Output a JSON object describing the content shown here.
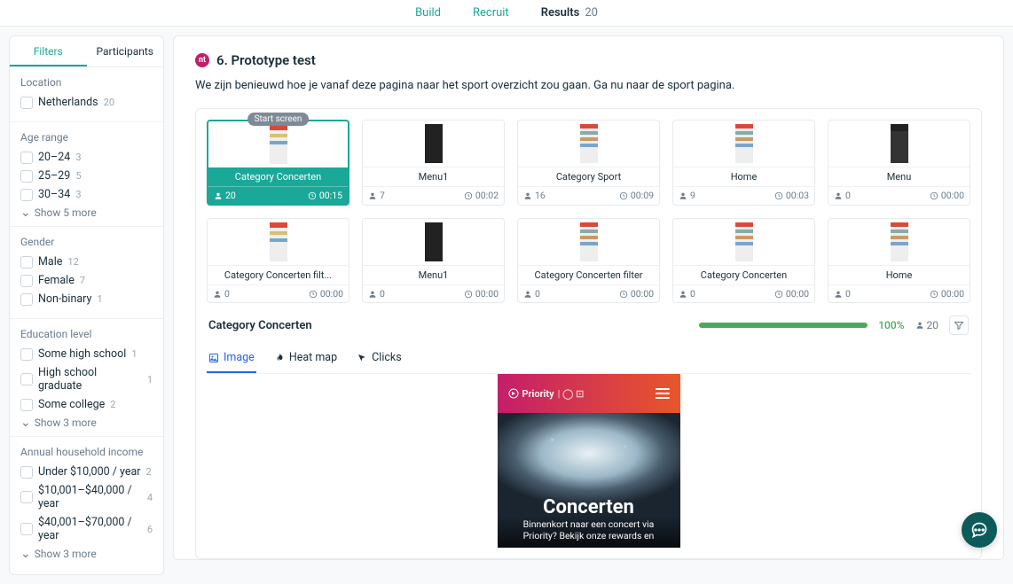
{
  "nav": {
    "steps": [
      {
        "label": "Build",
        "active": false,
        "link": true
      },
      {
        "label": "Recruit",
        "active": false,
        "link": true
      },
      {
        "label": "Results",
        "active": true,
        "count": "20"
      }
    ]
  },
  "sidebar_tabs": {
    "filters": "Filters",
    "participants": "Participants"
  },
  "filters": {
    "location": {
      "title": "Location",
      "items": [
        {
          "label": "Netherlands",
          "count": "20"
        }
      ]
    },
    "age": {
      "title": "Age range",
      "items": [
        {
          "label": "20–24",
          "count": "3"
        },
        {
          "label": "25–29",
          "count": "5"
        },
        {
          "label": "30–34",
          "count": "3"
        }
      ],
      "more": "Show 5 more"
    },
    "gender": {
      "title": "Gender",
      "items": [
        {
          "label": "Male",
          "count": "12"
        },
        {
          "label": "Female",
          "count": "7"
        },
        {
          "label": "Non-binary",
          "count": "1"
        }
      ]
    },
    "education": {
      "title": "Education level",
      "items": [
        {
          "label": "Some high school",
          "count": "1"
        },
        {
          "label": "High school graduate",
          "count": "1"
        },
        {
          "label": "Some college",
          "count": "2"
        }
      ],
      "more": "Show 3 more"
    },
    "income": {
      "title": "Annual household income",
      "items": [
        {
          "label": "Under $10,000 / year",
          "count": "2"
        },
        {
          "label": "$10,001–$40,000 / year",
          "count": "4"
        },
        {
          "label": "$40,001–$70,000 / year",
          "count": "6"
        }
      ],
      "more": "Show 3 more"
    }
  },
  "section": {
    "badge": "nt",
    "title": "6. Prototype test",
    "description": "We zijn benieuwd hoe je vanaf deze pagina naar het sport overzicht zou gaan. Ga nu naar de sport pagina."
  },
  "start_tag": "Start screen",
  "screens": [
    {
      "name": "Category Concerten",
      "people": "20",
      "time": "00:15",
      "selected": true,
      "thumb": "phonelike"
    },
    {
      "name": "Menu1",
      "people": "7",
      "time": "00:02",
      "thumb": "dark"
    },
    {
      "name": "Category Sport",
      "people": "16",
      "time": "00:09",
      "thumb": "strip"
    },
    {
      "name": "Home",
      "people": "9",
      "time": "00:03",
      "thumb": "strip"
    },
    {
      "name": "Menu",
      "people": "0",
      "time": "00:00",
      "thumb": "menu"
    },
    {
      "name": "Category Concerten filt...",
      "people": "0",
      "time": "00:00",
      "thumb": "phonelike"
    },
    {
      "name": "Menu1",
      "people": "0",
      "time": "00:00",
      "thumb": "dark"
    },
    {
      "name": "Category Concerten filter",
      "people": "0",
      "time": "00:00",
      "thumb": "strip"
    },
    {
      "name": "Category Concerten",
      "people": "0",
      "time": "00:00",
      "thumb": "strip"
    },
    {
      "name": "Home",
      "people": "0",
      "time": "00:00",
      "thumb": "strip"
    }
  ],
  "detail": {
    "name": "Category Concerten",
    "percent": "100%",
    "people": "20"
  },
  "view_tabs": {
    "image": "Image",
    "heat": "Heat map",
    "clicks": "Clicks"
  },
  "preview": {
    "brand": "Priority",
    "title": "Concerten",
    "subtitle": "Binnenkort naar een concert via Priority? Bekijk onze rewards en"
  }
}
